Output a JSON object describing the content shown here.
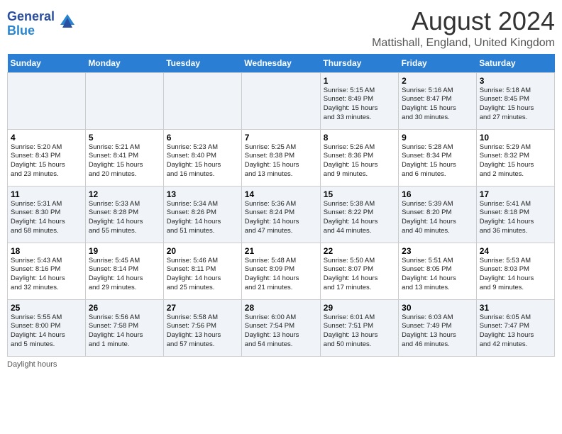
{
  "app": {
    "logo_line1": "General",
    "logo_line2": "Blue",
    "main_title": "August 2024",
    "subtitle": "Mattishall, England, United Kingdom"
  },
  "calendar": {
    "headers": [
      "Sunday",
      "Monday",
      "Tuesday",
      "Wednesday",
      "Thursday",
      "Friday",
      "Saturday"
    ],
    "weeks": [
      [
        {
          "day": "",
          "info": ""
        },
        {
          "day": "",
          "info": ""
        },
        {
          "day": "",
          "info": ""
        },
        {
          "day": "",
          "info": ""
        },
        {
          "day": "1",
          "info": "Sunrise: 5:15 AM\nSunset: 8:49 PM\nDaylight: 15 hours\nand 33 minutes."
        },
        {
          "day": "2",
          "info": "Sunrise: 5:16 AM\nSunset: 8:47 PM\nDaylight: 15 hours\nand 30 minutes."
        },
        {
          "day": "3",
          "info": "Sunrise: 5:18 AM\nSunset: 8:45 PM\nDaylight: 15 hours\nand 27 minutes."
        }
      ],
      [
        {
          "day": "4",
          "info": "Sunrise: 5:20 AM\nSunset: 8:43 PM\nDaylight: 15 hours\nand 23 minutes."
        },
        {
          "day": "5",
          "info": "Sunrise: 5:21 AM\nSunset: 8:41 PM\nDaylight: 15 hours\nand 20 minutes."
        },
        {
          "day": "6",
          "info": "Sunrise: 5:23 AM\nSunset: 8:40 PM\nDaylight: 15 hours\nand 16 minutes."
        },
        {
          "day": "7",
          "info": "Sunrise: 5:25 AM\nSunset: 8:38 PM\nDaylight: 15 hours\nand 13 minutes."
        },
        {
          "day": "8",
          "info": "Sunrise: 5:26 AM\nSunset: 8:36 PM\nDaylight: 15 hours\nand 9 minutes."
        },
        {
          "day": "9",
          "info": "Sunrise: 5:28 AM\nSunset: 8:34 PM\nDaylight: 15 hours\nand 6 minutes."
        },
        {
          "day": "10",
          "info": "Sunrise: 5:29 AM\nSunset: 8:32 PM\nDaylight: 15 hours\nand 2 minutes."
        }
      ],
      [
        {
          "day": "11",
          "info": "Sunrise: 5:31 AM\nSunset: 8:30 PM\nDaylight: 14 hours\nand 58 minutes."
        },
        {
          "day": "12",
          "info": "Sunrise: 5:33 AM\nSunset: 8:28 PM\nDaylight: 14 hours\nand 55 minutes."
        },
        {
          "day": "13",
          "info": "Sunrise: 5:34 AM\nSunset: 8:26 PM\nDaylight: 14 hours\nand 51 minutes."
        },
        {
          "day": "14",
          "info": "Sunrise: 5:36 AM\nSunset: 8:24 PM\nDaylight: 14 hours\nand 47 minutes."
        },
        {
          "day": "15",
          "info": "Sunrise: 5:38 AM\nSunset: 8:22 PM\nDaylight: 14 hours\nand 44 minutes."
        },
        {
          "day": "16",
          "info": "Sunrise: 5:39 AM\nSunset: 8:20 PM\nDaylight: 14 hours\nand 40 minutes."
        },
        {
          "day": "17",
          "info": "Sunrise: 5:41 AM\nSunset: 8:18 PM\nDaylight: 14 hours\nand 36 minutes."
        }
      ],
      [
        {
          "day": "18",
          "info": "Sunrise: 5:43 AM\nSunset: 8:16 PM\nDaylight: 14 hours\nand 32 minutes."
        },
        {
          "day": "19",
          "info": "Sunrise: 5:45 AM\nSunset: 8:14 PM\nDaylight: 14 hours\nand 29 minutes."
        },
        {
          "day": "20",
          "info": "Sunrise: 5:46 AM\nSunset: 8:11 PM\nDaylight: 14 hours\nand 25 minutes."
        },
        {
          "day": "21",
          "info": "Sunrise: 5:48 AM\nSunset: 8:09 PM\nDaylight: 14 hours\nand 21 minutes."
        },
        {
          "day": "22",
          "info": "Sunrise: 5:50 AM\nSunset: 8:07 PM\nDaylight: 14 hours\nand 17 minutes."
        },
        {
          "day": "23",
          "info": "Sunrise: 5:51 AM\nSunset: 8:05 PM\nDaylight: 14 hours\nand 13 minutes."
        },
        {
          "day": "24",
          "info": "Sunrise: 5:53 AM\nSunset: 8:03 PM\nDaylight: 14 hours\nand 9 minutes."
        }
      ],
      [
        {
          "day": "25",
          "info": "Sunrise: 5:55 AM\nSunset: 8:00 PM\nDaylight: 14 hours\nand 5 minutes."
        },
        {
          "day": "26",
          "info": "Sunrise: 5:56 AM\nSunset: 7:58 PM\nDaylight: 14 hours\nand 1 minute."
        },
        {
          "day": "27",
          "info": "Sunrise: 5:58 AM\nSunset: 7:56 PM\nDaylight: 13 hours\nand 57 minutes."
        },
        {
          "day": "28",
          "info": "Sunrise: 6:00 AM\nSunset: 7:54 PM\nDaylight: 13 hours\nand 54 minutes."
        },
        {
          "day": "29",
          "info": "Sunrise: 6:01 AM\nSunset: 7:51 PM\nDaylight: 13 hours\nand 50 minutes."
        },
        {
          "day": "30",
          "info": "Sunrise: 6:03 AM\nSunset: 7:49 PM\nDaylight: 13 hours\nand 46 minutes."
        },
        {
          "day": "31",
          "info": "Sunrise: 6:05 AM\nSunset: 7:47 PM\nDaylight: 13 hours\nand 42 minutes."
        }
      ]
    ],
    "footer": "Daylight hours"
  }
}
